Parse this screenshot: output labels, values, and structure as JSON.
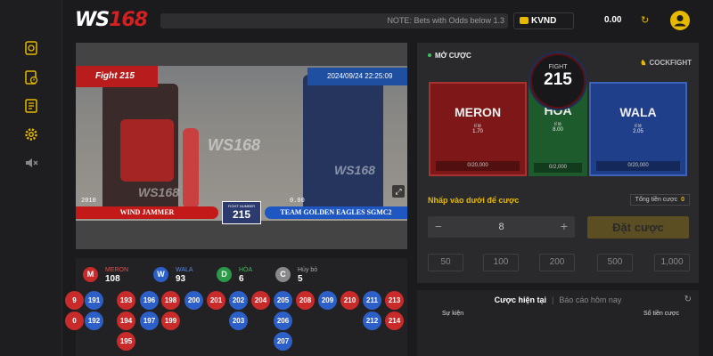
{
  "sidebar": {
    "icons": [
      "game-icon",
      "bet-history-icon",
      "report-icon",
      "settings-icon",
      "volume-mute-icon"
    ]
  },
  "header": {
    "logo_main": "WS",
    "logo_accent": "168",
    "note": "NOTE: Bets with Odds below 1.3",
    "currency": "KVND",
    "balance": "0.00"
  },
  "video": {
    "fight_label": "Fight 215",
    "datetime": "2024/09/24 22:25:09",
    "watermark": "WS168",
    "meron_name": "WIND JAMMER",
    "wala_name": "TEAM GOLDEN EAGLES SGMC2",
    "fight_number_label": "FIGHT NUMBER",
    "fight_number": "215",
    "left_score": "2010",
    "right_score": "0.00"
  },
  "bet_panel": {
    "open_label": "MỞ CƯỢC",
    "category": "COCKFIGHT",
    "fight_label": "FIGHT",
    "fight_number": "215",
    "meron": {
      "name": "MERON",
      "rate_label": "tỉ lệ",
      "rate": "1.70",
      "total": "0/20,000"
    },
    "hoa": {
      "name": "HÒA",
      "rate_label": "tỉ lệ",
      "rate": "8.00",
      "total": "0/2,000"
    },
    "wala": {
      "name": "WALA",
      "rate_label": "tỉ lệ",
      "rate": "2.05",
      "total": "0/20,000"
    },
    "enter_label": "Nhấp vào dưới để cược",
    "total_label": "Tổng tiền cược",
    "total_value": "0",
    "amount": "8",
    "place_bet": "Đặt cược",
    "chips": [
      "50",
      "100",
      "200",
      "500",
      "1,000"
    ]
  },
  "stats": {
    "meron": {
      "letter": "M",
      "label": "MERON",
      "count": "108"
    },
    "wala": {
      "letter": "W",
      "label": "WALA",
      "count": "93"
    },
    "hoa": {
      "letter": "D",
      "label": "HÒA",
      "count": "6"
    },
    "huy": {
      "letter": "C",
      "label": "Hủy bỏ",
      "count": "5"
    }
  },
  "results_grid": [
    {
      "n": "9",
      "c": "red",
      "col": 0,
      "row": 0
    },
    {
      "n": "191",
      "c": "blue",
      "col": 1,
      "row": 0
    },
    {
      "n": "193",
      "c": "red",
      "col": 2,
      "row": 0
    },
    {
      "n": "196",
      "c": "blue",
      "col": 3,
      "row": 0
    },
    {
      "n": "198",
      "c": "red",
      "col": 4,
      "row": 0
    },
    {
      "n": "200",
      "c": "blue",
      "col": 5,
      "row": 0
    },
    {
      "n": "201",
      "c": "red",
      "col": 6,
      "row": 0
    },
    {
      "n": "202",
      "c": "blue",
      "col": 7,
      "row": 0
    },
    {
      "n": "204",
      "c": "red",
      "col": 8,
      "row": 0
    },
    {
      "n": "205",
      "c": "blue",
      "col": 9,
      "row": 0
    },
    {
      "n": "208",
      "c": "red",
      "col": 10,
      "row": 0
    },
    {
      "n": "209",
      "c": "blue",
      "col": 11,
      "row": 0
    },
    {
      "n": "210",
      "c": "red",
      "col": 12,
      "row": 0
    },
    {
      "n": "211",
      "c": "blue",
      "col": 13,
      "row": 0
    },
    {
      "n": "213",
      "c": "red",
      "col": 14,
      "row": 0
    },
    {
      "n": "0",
      "c": "red",
      "col": 0,
      "row": 1
    },
    {
      "n": "192",
      "c": "blue",
      "col": 1,
      "row": 1
    },
    {
      "n": "194",
      "c": "red",
      "col": 2,
      "row": 1
    },
    {
      "n": "197",
      "c": "blue",
      "col": 3,
      "row": 1
    },
    {
      "n": "199",
      "c": "red",
      "col": 4,
      "row": 1
    },
    {
      "n": "203",
      "c": "blue",
      "col": 7,
      "row": 1
    },
    {
      "n": "206",
      "c": "blue",
      "col": 9,
      "row": 1
    },
    {
      "n": "212",
      "c": "blue",
      "col": 13,
      "row": 1
    },
    {
      "n": "214",
      "c": "red",
      "col": 14,
      "row": 1
    },
    {
      "n": "195",
      "c": "red",
      "col": 2,
      "row": 2
    },
    {
      "n": "207",
      "c": "blue",
      "col": 9,
      "row": 2
    }
  ],
  "history": {
    "tab_current": "Cược hiện tại",
    "tab_today": "Báo cáo hôm nay",
    "col_event": "Sự kiện",
    "col_amount": "Số tiền cược"
  },
  "colors": {
    "accent": "#e6b800",
    "meron": "#c92a2a",
    "wala": "#2c5fc7",
    "hoa": "#1d5a2c"
  }
}
